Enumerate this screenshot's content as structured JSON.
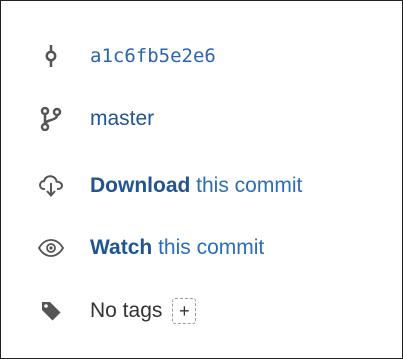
{
  "commit": {
    "hash": "a1c6fb5e2e6",
    "hash_icon": "commit-icon"
  },
  "branch": {
    "name": "master",
    "icon": "branch-icon"
  },
  "download": {
    "action": "Download",
    "suffix": " this commit",
    "icon": "cloud-download-icon"
  },
  "watch": {
    "action": "Watch",
    "suffix": " this commit",
    "icon": "eye-icon"
  },
  "tags": {
    "label": "No tags",
    "add_label": "+",
    "icon": "tag-icon"
  },
  "colors": {
    "link": "#205493",
    "hash": "#2b66ad",
    "icon": "#555555",
    "text": "#333333",
    "border": "#222222"
  }
}
